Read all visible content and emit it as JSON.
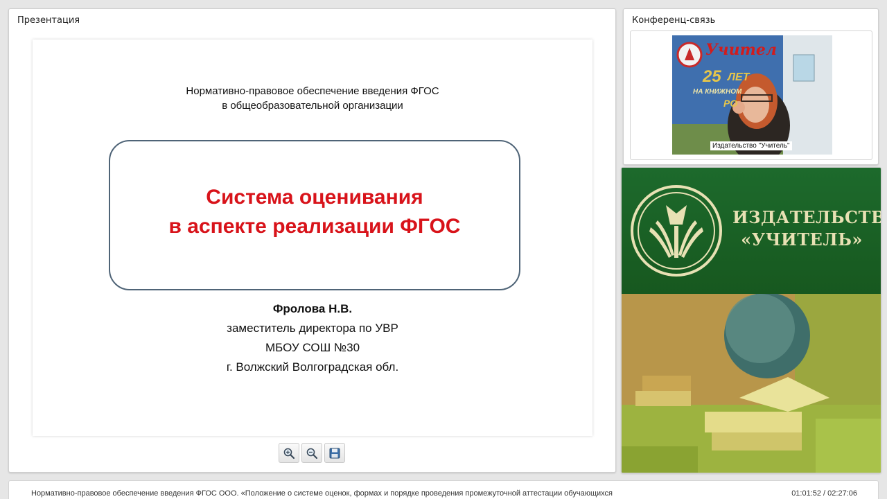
{
  "presentation": {
    "title": "Презентация",
    "slide": {
      "header_line1": "Нормативно-правовое  обеспечение введения  ФГОС",
      "header_line2": "в общеобразовательной организации",
      "main_line1": "Система оценивания",
      "main_line2": "в аспекте реализации  ФГОС",
      "author_name": "Фролова Н.В.",
      "author_line1": "заместитель директора по УВР",
      "author_line2": "МБОУ СОШ №30",
      "author_line3": "г. Волжский Волгоградская обл."
    },
    "toolbar": {
      "zoom_in": "zoom-in-icon",
      "zoom_out": "zoom-out-icon",
      "save": "save-icon"
    }
  },
  "conference": {
    "title": "Конференц-связь",
    "video_label": "Издательство \"Учитель\"",
    "banner_text_1": "Учител",
    "banner_text_2": "25",
    "banner_text_3": "ЛЕТ",
    "banner_text_4": "НА КНИЖНОМ",
    "banner_text_5": "РО"
  },
  "publisher": {
    "name_line1": "ИЗДАТЕЛЬСТВО",
    "name_line2": "«УЧИТЕЛЬ»"
  },
  "footer": {
    "description": "Нормативно-правовое обеспечение введения ФГОС ООО. «Положение о системе оценок, формах и порядке проведения промежуточной аттестации обучающихся",
    "time": "01:01:52 / 02:27:06"
  },
  "colors": {
    "accent_red": "#d8131a",
    "box_border": "#4f6477",
    "publisher_green": "#1d6a2c",
    "publisher_gold": "#e8e1b4"
  }
}
